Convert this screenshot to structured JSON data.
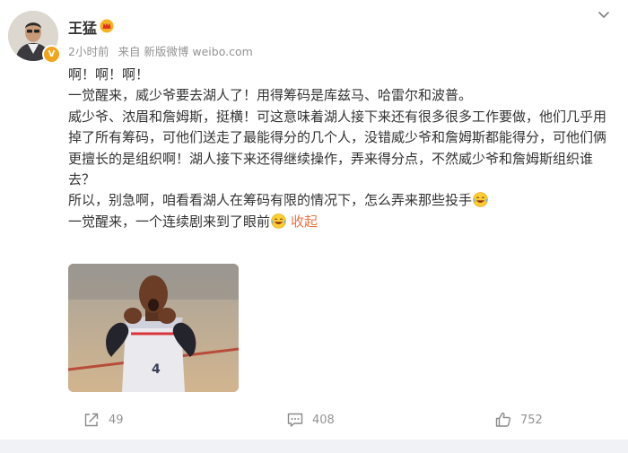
{
  "author": {
    "name": "王猛",
    "verified_badge": "V"
  },
  "meta": {
    "time": "2小时前",
    "source": "来自 新版微博 weibo.com"
  },
  "post": {
    "paragraphs": [
      "啊！啊！啊！",
      "一觉醒来，威少爷要去湖人了！用得筹码是库兹马、哈雷尔和波普。",
      "威少爷、浓眉和詹姆斯，挺横！可这意味着湖人接下来还有很多很多工作要做，他们几乎用掉了所有筹码，可他们送走了最能得分的几个人，没错威少爷和詹姆斯都能得分，可他们俩更擅长的是组织啊！湖人接下来还得继续操作，弄来得分点，不然威少爷和詹姆斯组织谁去？",
      "所以，别急啊，咱看看湖人在筹码有限的情况下，怎么弄来那些投手",
      "一觉醒来，一个连续剧来到了眼前"
    ],
    "collapse_label": "收起"
  },
  "actions": {
    "share_count": "49",
    "comment_count": "408",
    "like_count": "752"
  },
  "colors": {
    "link": "#eb7340",
    "meta_text": "#939393",
    "body_text": "#333333",
    "badge_gold": "#f2a51a"
  },
  "icons": {
    "more": "chevron-down-icon",
    "share": "share-icon",
    "comment": "comment-icon",
    "like": "thumbs-up-icon",
    "emoji": "laugh-emoji-icon"
  }
}
